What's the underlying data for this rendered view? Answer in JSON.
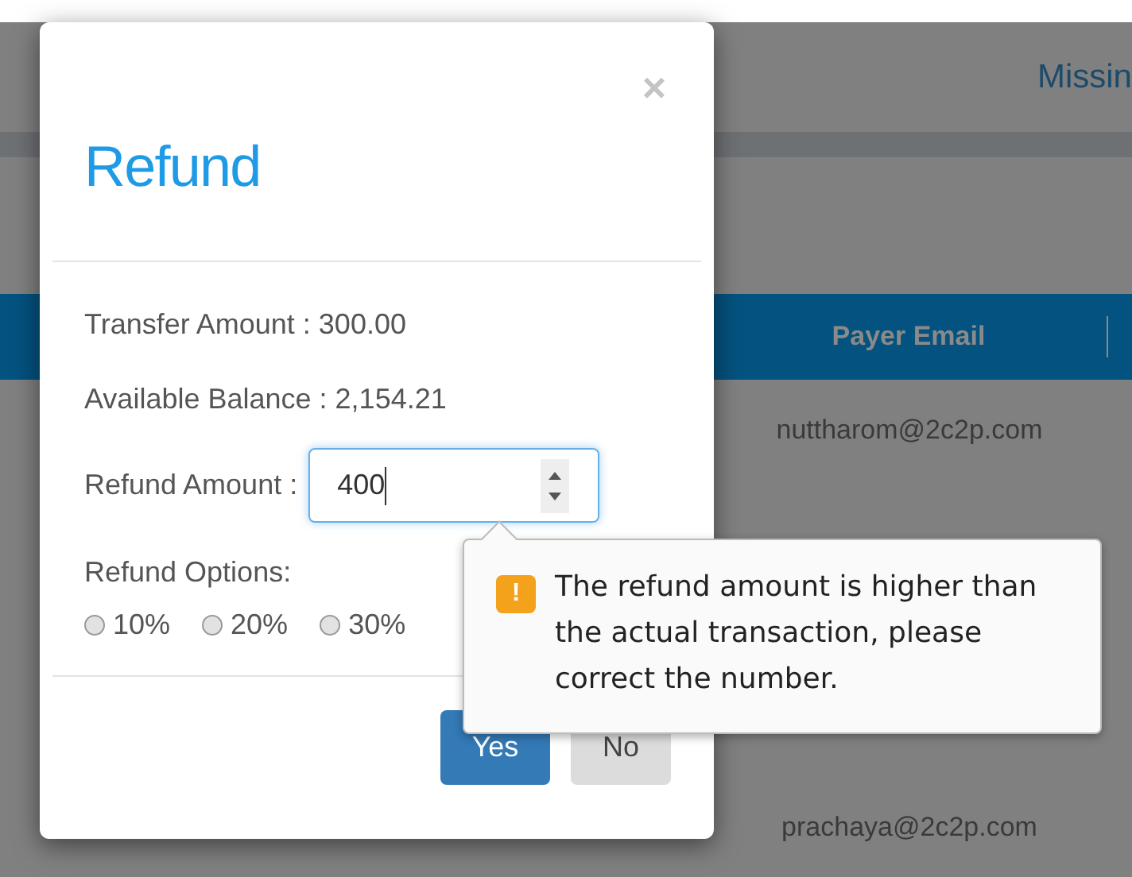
{
  "background": {
    "header_link": "Missin",
    "table": {
      "columns": [
        {
          "label": "Payer Email"
        }
      ],
      "rows": [
        {
          "payer_email": "nuttharom@2c2p.com"
        },
        {
          "payer_email": "prachaya@2c2p.com"
        }
      ]
    }
  },
  "dialog": {
    "title": "Refund",
    "close": "×",
    "info": [
      {
        "label": "Transfer Amount :",
        "value": "300.00"
      },
      {
        "label": "Available Balance :",
        "value": "2,154.21"
      }
    ],
    "refund_amount": {
      "label": "Refund Amount :",
      "value": "400"
    },
    "refund_options": {
      "label": "Refund Options:",
      "options": [
        {
          "label": "10%",
          "selected": false
        },
        {
          "label": "20%",
          "selected": false
        },
        {
          "label": "30%",
          "selected": false
        }
      ]
    },
    "buttons": [
      {
        "label": "Yes",
        "kind": "primary"
      },
      {
        "label": "No",
        "kind": "secondary"
      }
    ]
  },
  "tooltip": {
    "icon": "!",
    "message": "The refund amount is higher than the actual transaction, please correct the number."
  }
}
